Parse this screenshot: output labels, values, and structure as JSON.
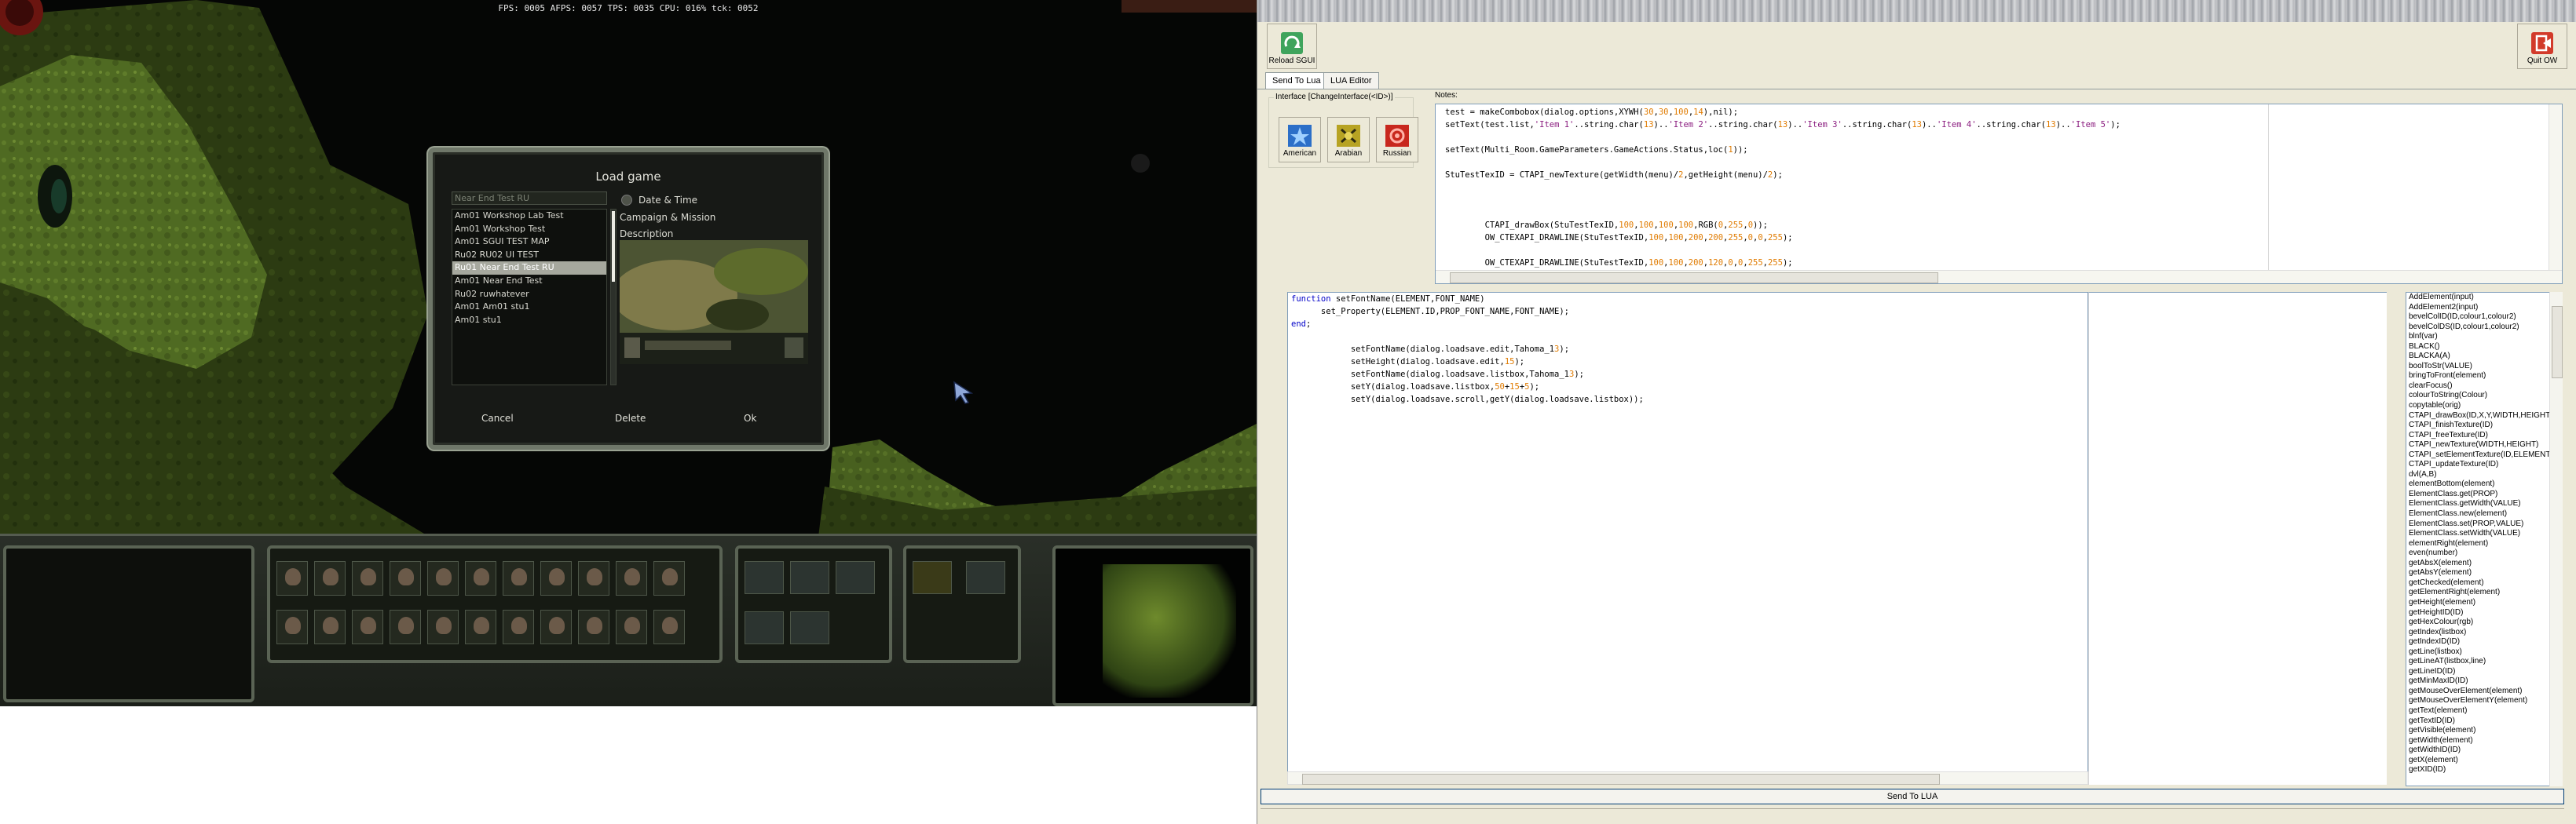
{
  "game": {
    "stats": "FPS: 0005 AFPS: 0057 TPS: 0035 CPU: 016% tck: 0052",
    "dialog": {
      "title": "Load game",
      "search_value": "Near End Test RU",
      "saves": [
        "Am01 Workshop Lab Test",
        "Am01 Workshop Test",
        "Am01 SGUI TEST MAP",
        "Ru02 RU02 UI TEST",
        "Ru01 Near End Test RU",
        "Am01 Near End Test",
        "Ru02 ruwhatever",
        "Am01 Am01 stu1",
        "Am01 stu1"
      ],
      "selected_index": 4,
      "sort_options": [
        "Date & Time",
        "Campaign & Mission",
        "Description"
      ],
      "cancel_label": "Cancel",
      "delete_label": "Delete",
      "ok_label": "Ok"
    }
  },
  "panel": {
    "reload_label": "Reload SGUI",
    "quit_label": "Quit OW",
    "tabs": [
      "Send To Lua",
      "LUA Editor"
    ],
    "interface_group": "Interface [ChangeInterface(<ID>)]",
    "interfaces": [
      "American",
      "Arabian",
      "Russian"
    ],
    "notes_label": "Notes:",
    "notes_lines": [
      "test = makeCombobox(dialog.options,XYWH(30,30,100,14),nil);",
      "setText(test.list,'Item 1'..string.char(13)..'Item 2'..string.char(13)..'Item 3'..string.char(13)..'Item 4'..string.char(13)..'Item 5');",
      "",
      "setText(Multi_Room.GameParameters.GameActions.Status,loc(1));",
      "",
      "StuTestTexID = CTAPI_newTexture(getWidth(menu)/2,getHeight(menu)/2);",
      "",
      "",
      "",
      "        CTAPI_drawBox(StuTestTexID,100,100,100,100,RGB(0,255,0));",
      "        OW_CTEXAPI_DRAWLINE(StuTestTexID,100,100,200,200,255,0,0,255);",
      "",
      "        OW_CTEXAPI_DRAWLINE(StuTestTexID,100,100,200,120,0,0,255,255);"
    ],
    "editor_lines": [
      "function setFontName(ELEMENT,FONT_NAME)",
      "      set_Property(ELEMENT.ID,PROP_FONT_NAME,FONT_NAME);",
      "end;",
      "",
      "            setFontName(dialog.loadsave.edit,Tahoma_13);",
      "            setHeight(dialog.loadsave.edit,15);",
      "            setFontName(dialog.loadsave.listbox,Tahoma_13);",
      "            setY(dialog.loadsave.listbox,50+15+5);",
      "            setY(dialog.loadsave.scroll,getY(dialog.loadsave.listbox));"
    ],
    "functions": [
      "AddElement(input)",
      "AddElement2(input)",
      "bevelColID(ID,colour1,colour2)",
      "bevelColDS(ID,colour1,colour2)",
      "blnf(var)",
      "BLACK()",
      "BLACKA(A)",
      "boolToStr(VALUE)",
      "bringToFront(element)",
      "clearFocus()",
      "colourToString(Colour)",
      "copytable(orig)",
      "CTAPI_drawBox(ID,X,Y,WIDTH,HEIGHT,COLOUR)",
      "CTAPI_finishTexture(ID)",
      "CTAPI_freeTexture(ID)",
      "CTAPI_newTexture(WIDTH,HEIGHT)",
      "CTAPI_setElementTexture(ID,ELEMENT)",
      "CTAPI_updateTexture(ID)",
      "dvl(A,B)",
      "elementBottom(element)",
      "ElementClass.get(PROP)",
      "ElementClass.getWidth(VALUE)",
      "ElementClass.new(element)",
      "ElementClass.set(PROP,VALUE)",
      "ElementClass.setWidth(VALUE)",
      "elementRight(element)",
      "even(number)",
      "getAbsX(element)",
      "getAbsY(element)",
      "getChecked(element)",
      "getElementRight(element)",
      "getHeight(element)",
      "getHeightID(ID)",
      "getHexColour(rgb)",
      "getIndex(listbox)",
      "getIndexID(ID)",
      "getLine(listbox)",
      "getLineAT(listbox,line)",
      "getLineID(ID)",
      "getMinMaxID(ID)",
      "getMouseOverElement(element)",
      "getMouseOverElementY(element)",
      "getText(element)",
      "getTextID(ID)",
      "getVisible(element)",
      "getWidth(element)",
      "getWidthID(ID)",
      "getX(element)",
      "getXID(ID)"
    ],
    "send_label": "Send To LUA"
  }
}
